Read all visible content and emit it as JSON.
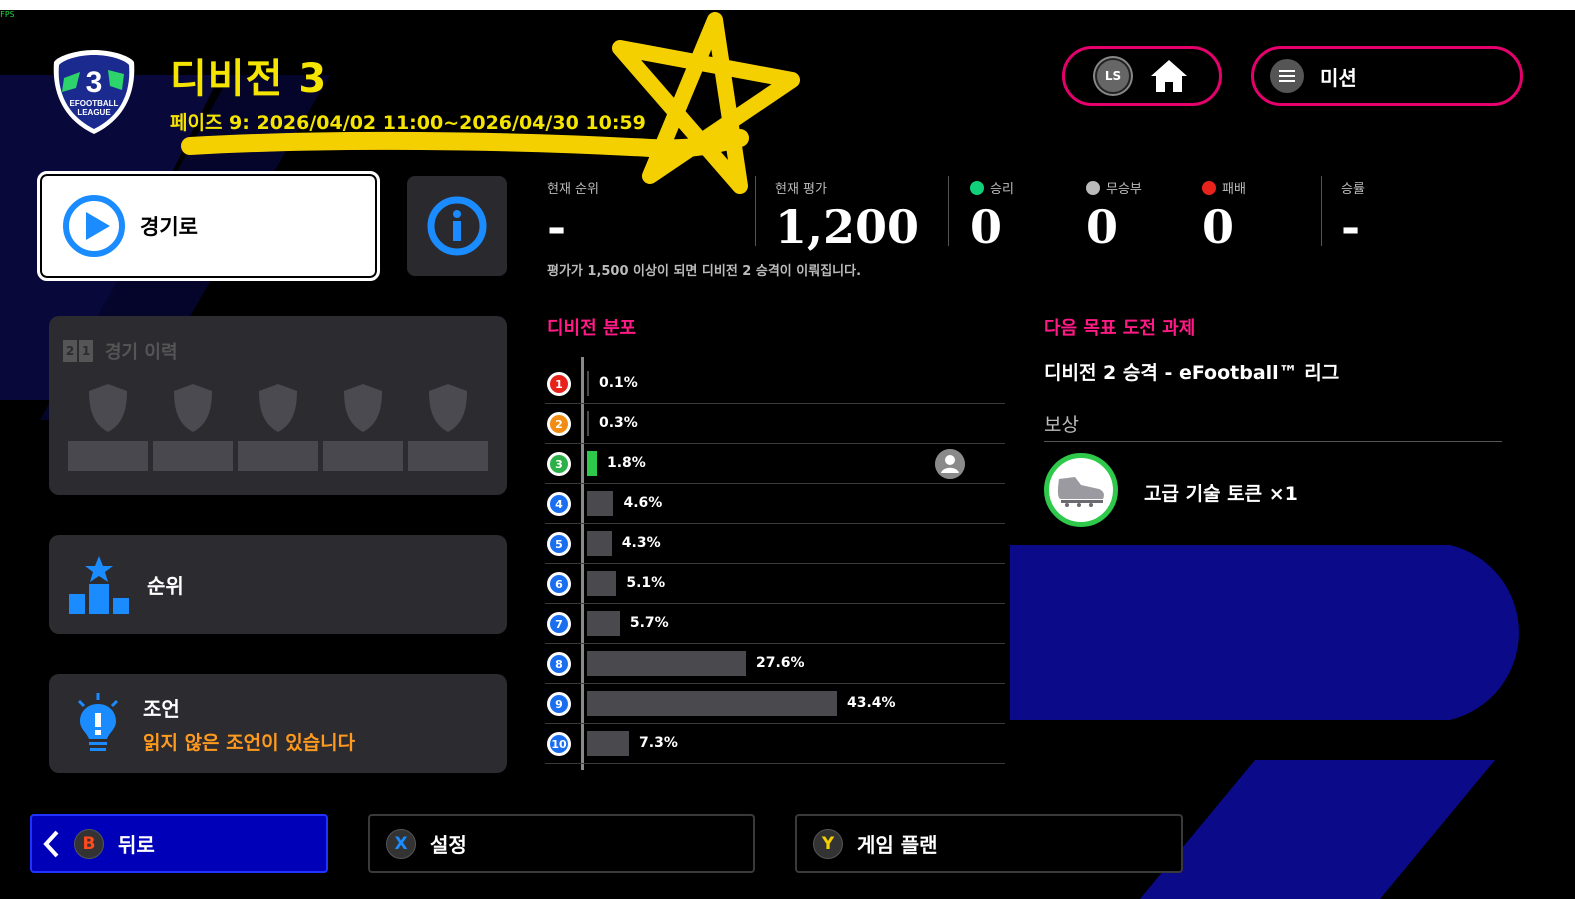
{
  "overlay": {
    "fps_label": "FPS"
  },
  "header": {
    "division_title": "디비전 3",
    "badge": {
      "number": "3",
      "line1": "EFOOTBALL",
      "line2": "LEAGUE"
    },
    "phase_text": "페이즈 9: 2026/04/02 11:00~2026/04/30 10:59",
    "ls_label": "LS",
    "mission_label": "미션"
  },
  "left": {
    "play_label": "경기로",
    "history": {
      "title": "경기 이력",
      "icon_digits": [
        "2",
        "1"
      ],
      "slots": 5
    },
    "rank_label": "순위",
    "advice": {
      "title": "조언",
      "subtitle": "읽지 않은 조언이 있습니다"
    }
  },
  "stats": {
    "current_rank": {
      "label": "현재 순위",
      "value": "-"
    },
    "current_rating": {
      "label": "현재 평가",
      "value": "1,200"
    },
    "wins": {
      "label": "승리",
      "value": "0",
      "color": "#10d07a"
    },
    "draws": {
      "label": "무승부",
      "value": "0",
      "color": "#bbbbbb"
    },
    "losses": {
      "label": "패배",
      "value": "0",
      "color": "#e8231c"
    },
    "win_rate": {
      "label": "승률",
      "value": "-"
    },
    "promotion_note": "평가가 1,500 이상이 되면 디비전 2 승격이 이뤄집니다."
  },
  "distribution": {
    "title": "디비전 분포",
    "current_division": 3,
    "chart_data": {
      "type": "bar",
      "orientation": "horizontal",
      "categories": [
        "1",
        "2",
        "3",
        "4",
        "5",
        "6",
        "7",
        "8",
        "9",
        "10"
      ],
      "values": [
        0.1,
        0.3,
        1.8,
        4.6,
        4.3,
        5.1,
        5.7,
        27.6,
        43.4,
        7.3
      ],
      "labels": [
        "0.1%",
        "0.3%",
        "1.8%",
        "4.6%",
        "4.3%",
        "5.1%",
        "5.7%",
        "27.6%",
        "43.4%",
        "7.3%"
      ],
      "rank_colors": [
        "#e8231c",
        "#f28c12",
        "#2cb14a",
        "#1a6ff0",
        "#1a6ff0",
        "#1a6ff0",
        "#1a6ff0",
        "#1a6ff0",
        "#1a6ff0",
        "#1a6ff0"
      ],
      "highlight_index": 2,
      "highlight_color": "#2ec84a",
      "bar_color": "#4a4a4e"
    }
  },
  "goal": {
    "section_title": "다음 목표 도전 과제",
    "name": "디비전 2 승격 - eFootball™ 리그",
    "reward_label": "보상",
    "reward_name": "고급 기술 토큰 ×1"
  },
  "footer": {
    "back": {
      "glyph": "B",
      "label": "뒤로"
    },
    "settings": {
      "glyph": "X",
      "label": "설정"
    },
    "game_plan": {
      "glyph": "Y",
      "label": "게임 플랜"
    }
  },
  "colors": {
    "accent_pink": "#e5006e",
    "title_yellow": "#f5e400",
    "back_blue": "#0000b8"
  }
}
